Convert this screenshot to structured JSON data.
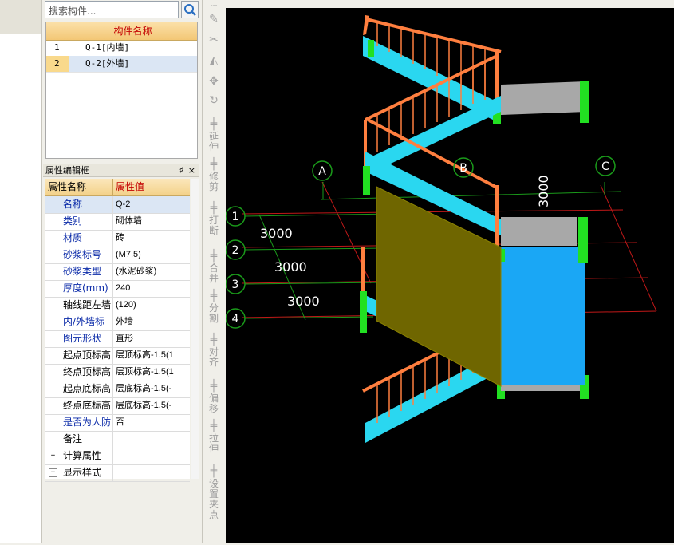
{
  "component_panel": {
    "search_placeholder": "搜索构件...",
    "column_header": "构件名称",
    "rows": [
      {
        "num": "1",
        "name": "Q-1[内墙]",
        "selected": false
      },
      {
        "num": "2",
        "name": "Q-2[外墙]",
        "selected": true
      }
    ]
  },
  "property_panel": {
    "title": "属性编辑框",
    "pin_glyph": "♯",
    "close_glyph": "×",
    "header_name": "属性名称",
    "header_value": "属性值",
    "rows": [
      {
        "name": "名称",
        "value": "Q-2"
      },
      {
        "name": "类别",
        "value": "砌体墙"
      },
      {
        "name": "材质",
        "value": "砖"
      },
      {
        "name": "砂浆标号",
        "value": "(M7.5)"
      },
      {
        "name": "砂浆类型",
        "value": "(水泥砂浆)"
      },
      {
        "name": "厚度(mm)",
        "value": "240"
      },
      {
        "name": "轴线距左墙",
        "value": "(120)"
      },
      {
        "name": "内/外墙标",
        "value": "外墙"
      },
      {
        "name": "图元形状",
        "value": "直形"
      },
      {
        "name": "起点顶标高",
        "value": "层顶标高-1.5(1"
      },
      {
        "name": "终点顶标高",
        "value": "层顶标高-1.5(1"
      },
      {
        "name": "起点底标高",
        "value": "层底标高-1.5(-"
      },
      {
        "name": "终点底标高",
        "value": "层底标高-1.5(-"
      },
      {
        "name": "是否为人防",
        "value": "否"
      },
      {
        "name": "备注",
        "value": ""
      },
      {
        "name": "计算属性",
        "value": ""
      },
      {
        "name": "显示样式",
        "value": ""
      }
    ]
  },
  "toolbar": {
    "tools": [
      {
        "label": "延伸",
        "icon": "extend-icon"
      },
      {
        "label": "修剪",
        "icon": "trim-icon"
      },
      {
        "label": "打断",
        "icon": "break-icon"
      },
      {
        "label": "合并",
        "icon": "merge-icon"
      },
      {
        "label": "分割",
        "icon": "split-icon"
      },
      {
        "label": "对齐",
        "icon": "align-icon"
      },
      {
        "label": "偏移",
        "icon": "offset-icon"
      },
      {
        "label": "拉伸",
        "icon": "stretch-icon"
      },
      {
        "label": "设置夹点",
        "icon": "grip-icon"
      }
    ]
  },
  "canvas": {
    "axis_letters": [
      "A",
      "B",
      "C"
    ],
    "axis_numbers": [
      "1",
      "2",
      "3",
      "4"
    ],
    "dimensions": [
      "3000",
      "3000",
      "3000",
      "3000"
    ],
    "colors": {
      "background": "#000000",
      "stair": "#2ad7f0",
      "railing": "#ff7f3f",
      "wall": "#6f6600",
      "wall_blue": "#1aa7f5",
      "slab": "#a8a8a8",
      "end_marker": "#22e022",
      "axis_line": "#1a9a1a",
      "grid_red": "#c01818"
    }
  }
}
